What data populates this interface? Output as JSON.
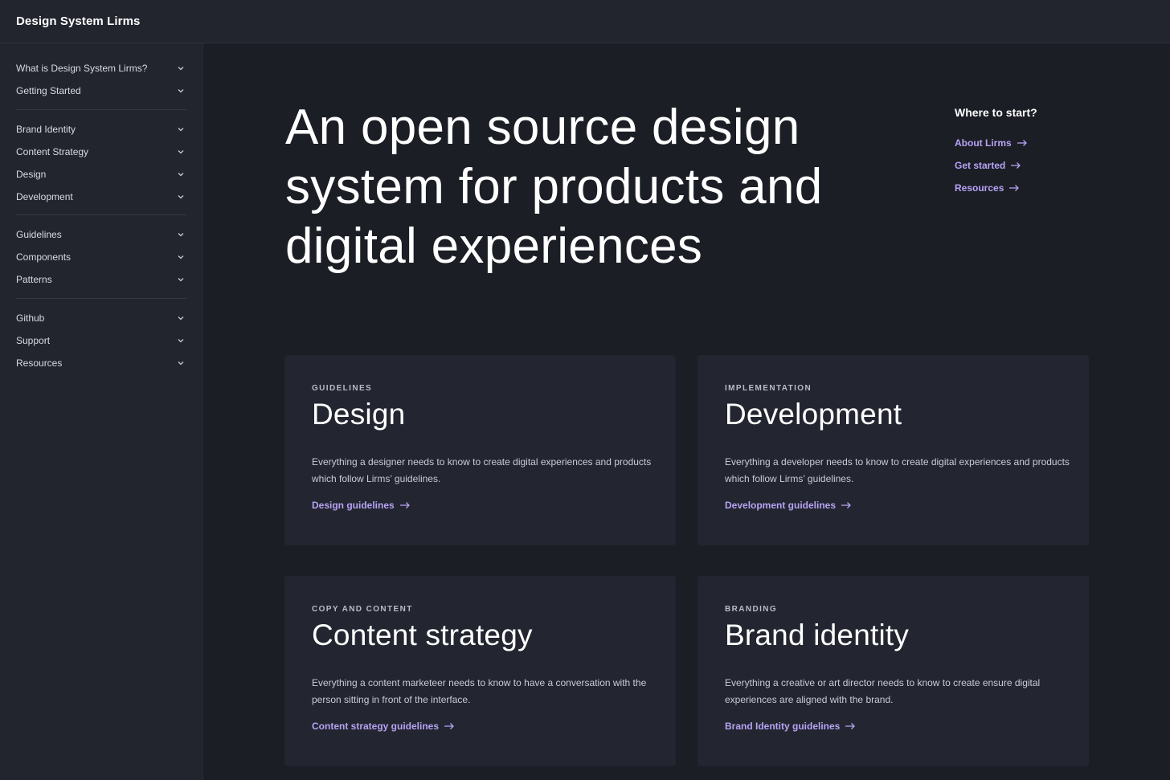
{
  "app": {
    "title": "Design System Lirms"
  },
  "sidebar": {
    "groups": [
      {
        "items": [
          {
            "label": "What is Design System Lirms?"
          },
          {
            "label": "Getting Started"
          }
        ]
      },
      {
        "items": [
          {
            "label": "Brand Identity"
          },
          {
            "label": "Content Strategy"
          },
          {
            "label": "Design"
          },
          {
            "label": "Development"
          }
        ]
      },
      {
        "items": [
          {
            "label": "Guidelines"
          },
          {
            "label": "Components"
          },
          {
            "label": "Patterns"
          }
        ]
      },
      {
        "items": [
          {
            "label": "Github"
          },
          {
            "label": "Support"
          },
          {
            "label": "Resources"
          }
        ]
      }
    ]
  },
  "hero": {
    "line1": "An open source design",
    "line2": "system for products and",
    "line3": "digital experiences"
  },
  "where": {
    "title": "Where to start?",
    "links": [
      {
        "label": "About Lirms"
      },
      {
        "label": "Get started"
      },
      {
        "label": "Resources"
      }
    ]
  },
  "cards": [
    {
      "eyebrow": "GUIDELINES",
      "title": "Design",
      "desc": "Everything a designer needs to know to create digital experiences and products which follow Lirms’ guidelines.",
      "link": "Design guidelines"
    },
    {
      "eyebrow": "IMPLEMENTATION",
      "title": "Development",
      "desc": "Everything a developer needs to know to create digital experiences and products which follow Lirms’ guidelines.",
      "link": "Development guidelines"
    },
    {
      "eyebrow": "COPY AND CONTENT",
      "title": "Content strategy",
      "desc": "Everything a content marketeer needs to know to have a conversation with the person sitting in front of the interface.",
      "link": "Content strategy guidelines"
    },
    {
      "eyebrow": "BRANDING",
      "title": "Brand identity",
      "desc": "Everything a creative or art director needs to know to create ensure digital experiences are aligned with the brand.",
      "link": "Brand Identity guidelines"
    }
  ],
  "colors": {
    "accent": "#b7a3f5",
    "background": "#1b1e25",
    "surface": "#232630"
  },
  "icons": {
    "nav_toggle": "chevron-down-icon",
    "link_arrow": "arrow-right-icon"
  }
}
